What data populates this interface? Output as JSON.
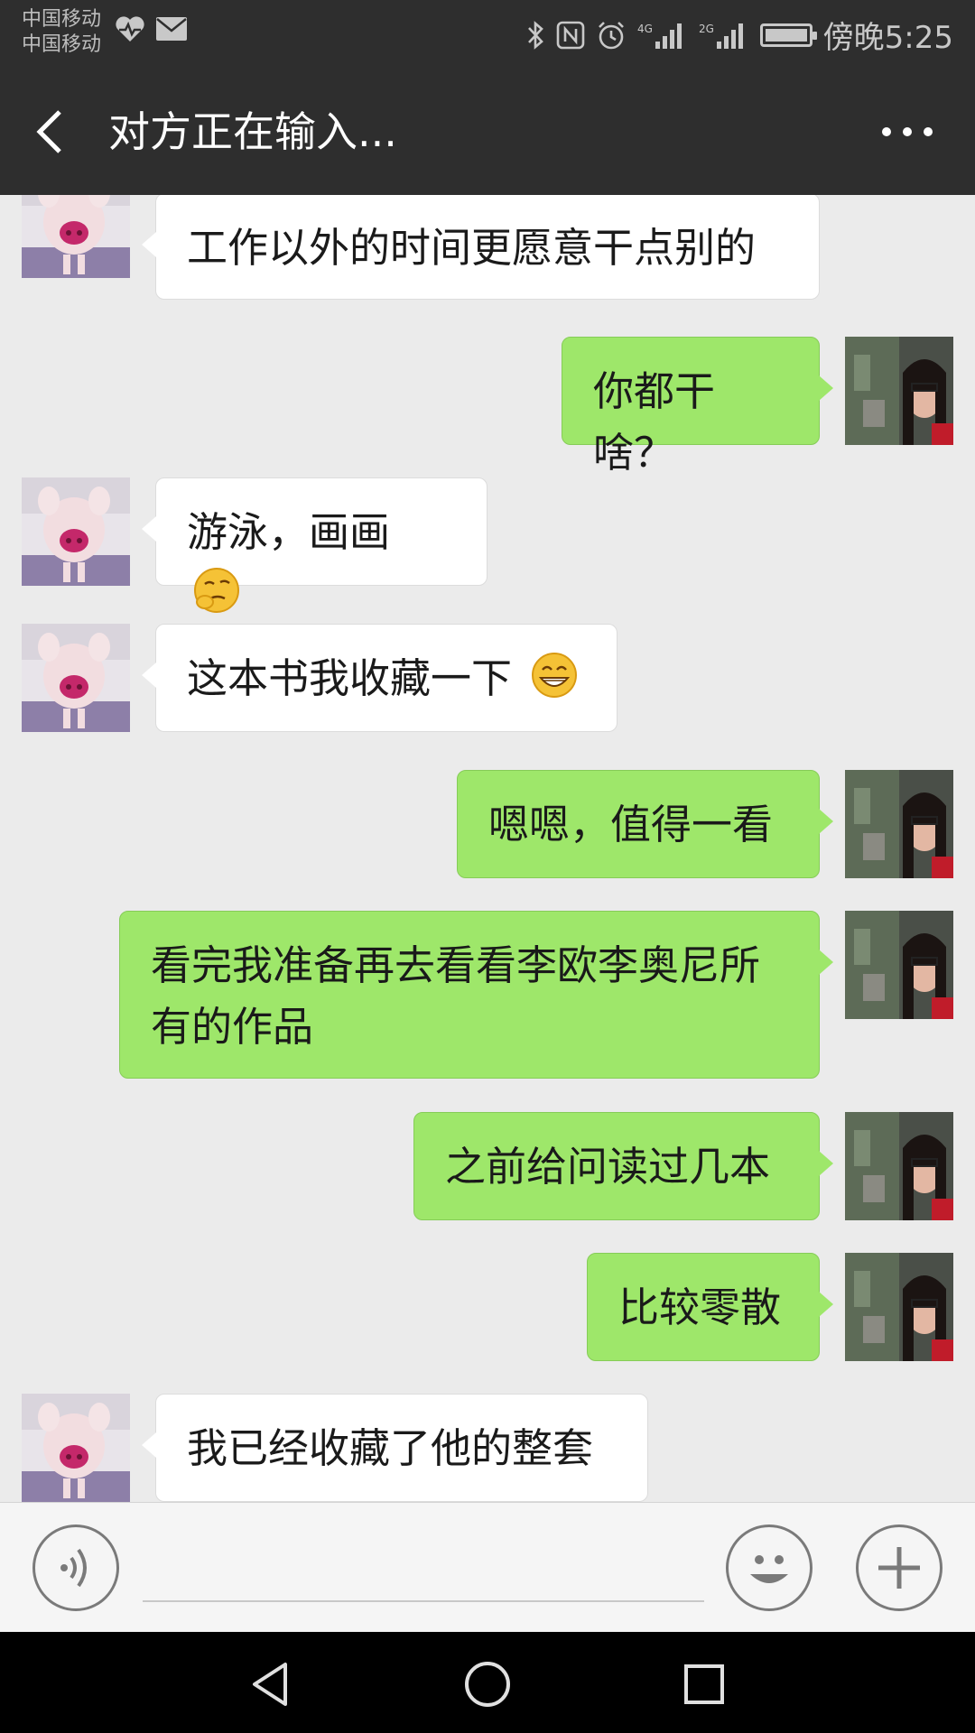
{
  "status_bar": {
    "carrier_1": "中国移动",
    "carrier_2": "中国移动",
    "time": "傍晚5:25",
    "network_1": "4G",
    "network_2": "2G"
  },
  "header": {
    "title": "对方正在输入..."
  },
  "messages": [
    {
      "side": "in",
      "text": "工作以外的时间更愿意干点别的",
      "emoji": ""
    },
    {
      "side": "out",
      "text": "你都干啥？",
      "emoji": ""
    },
    {
      "side": "in",
      "text": "游泳，画画",
      "emoji": "thinking-emoji"
    },
    {
      "side": "in",
      "text": "这本书我收藏一下",
      "emoji": "grin-emoji"
    },
    {
      "side": "out",
      "text": "嗯嗯，值得一看",
      "emoji": ""
    },
    {
      "side": "out",
      "text": "看完我准备再去看看李欧李奥尼所有的作品",
      "emoji": ""
    },
    {
      "side": "out",
      "text": "之前给问读过几本",
      "emoji": ""
    },
    {
      "side": "out",
      "text": "比较零散",
      "emoji": ""
    },
    {
      "side": "in",
      "text": "我已经收藏了他的整套",
      "emoji": ""
    }
  ],
  "colors": {
    "header_bg": "#2e2e2e",
    "chat_bg": "#ebebeb",
    "bubble_out": "#9ee76a",
    "bubble_in": "#ffffff"
  },
  "icons": {
    "back": "chevron-left-icon",
    "more": "more-dots-icon",
    "voice": "voice-icon",
    "emoji": "smiley-icon",
    "add": "plus-icon"
  }
}
